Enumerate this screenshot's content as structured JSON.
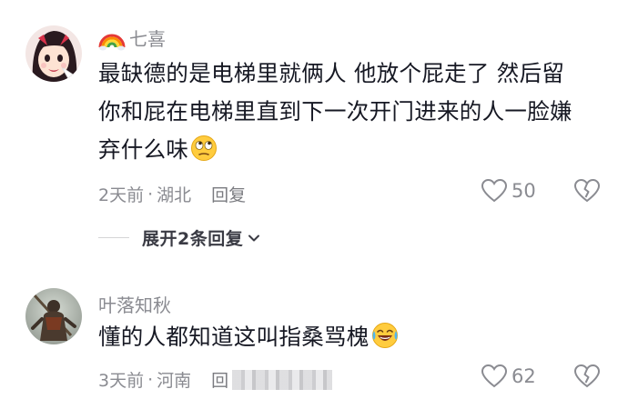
{
  "comments": [
    {
      "username": "七喜",
      "avatar": "anime-girl-avatar",
      "badge_icon": "rainbow-icon",
      "text_lines": [
        "最缺德的是电梯里就俩人 他放个屁走了 然后留",
        "你和屁在电梯里直到下一次开门进来的人一脸嫌",
        "弃什么味"
      ],
      "emoji": "eye-roll-emoji",
      "time": "2天前",
      "separator": "·",
      "location": "湖北",
      "reply_label": "回复",
      "likes": "50",
      "expand_label": "展开2条回复"
    },
    {
      "username": "叶落知秋",
      "avatar": "warrior-figure-avatar",
      "text_lines": [
        "懂的人都知道这叫指桑骂槐"
      ],
      "emoji": "laughing-crying-emoji",
      "time": "3天前",
      "separator": "·",
      "location": "河南",
      "reply_label": "回",
      "likes": "62"
    }
  ],
  "colors": {
    "text_primary": "#161823",
    "text_secondary": "#8a8b91",
    "background": "#ffffff"
  }
}
